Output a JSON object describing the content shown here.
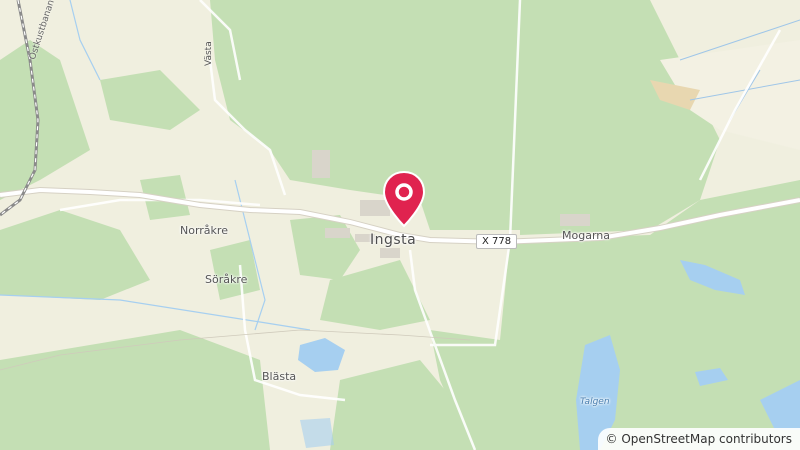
{
  "map": {
    "attribution": "© OpenStreetMap contributors",
    "marker_icon": "map-pin-icon",
    "colors": {
      "forest": "#c4dfb4",
      "farmland": "#f0efdf",
      "water": "#a6cff0",
      "road": "#ffffff",
      "marker": "#e0234f"
    },
    "labels": {
      "ingsta": "Ingsta",
      "norrakre": "Norråkre",
      "sorakre": "Söråkre",
      "blasta": "Blästa",
      "mogarna": "Mogarna",
      "talgen": "Talgen",
      "vasta": "Västa",
      "ostkustbanan": "Ostkustbanan",
      "road_ref": "X 778"
    }
  }
}
